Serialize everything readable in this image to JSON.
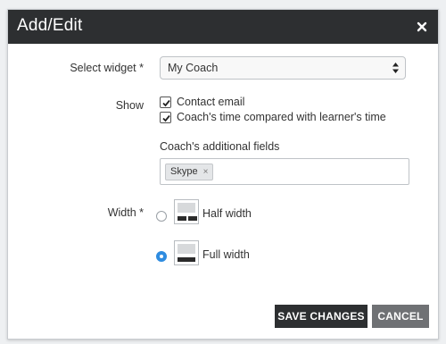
{
  "dialog": {
    "title": "Add/Edit",
    "close_glyph": "close-icon"
  },
  "form": {
    "select_widget": {
      "label": "Select widget *",
      "value": "My Coach"
    },
    "show": {
      "label": "Show",
      "options": [
        {
          "label": "Contact email",
          "checked": true
        },
        {
          "label": "Coach's time compared with learner's time",
          "checked": true
        }
      ]
    },
    "additional_fields": {
      "label": "Coach's additional fields",
      "tags": [
        "Skype"
      ],
      "remove_glyph": "×"
    },
    "width": {
      "label": "Width *",
      "options": [
        {
          "label": "Half width",
          "selected": false
        },
        {
          "label": "Full width",
          "selected": true
        }
      ]
    }
  },
  "buttons": {
    "save": "SAVE CHANGES",
    "cancel": "CANCEL"
  },
  "colors": {
    "titlebar": "#2d2f31",
    "radio_selected": "#2f8ce0",
    "cancel_button": "#6f7174"
  }
}
